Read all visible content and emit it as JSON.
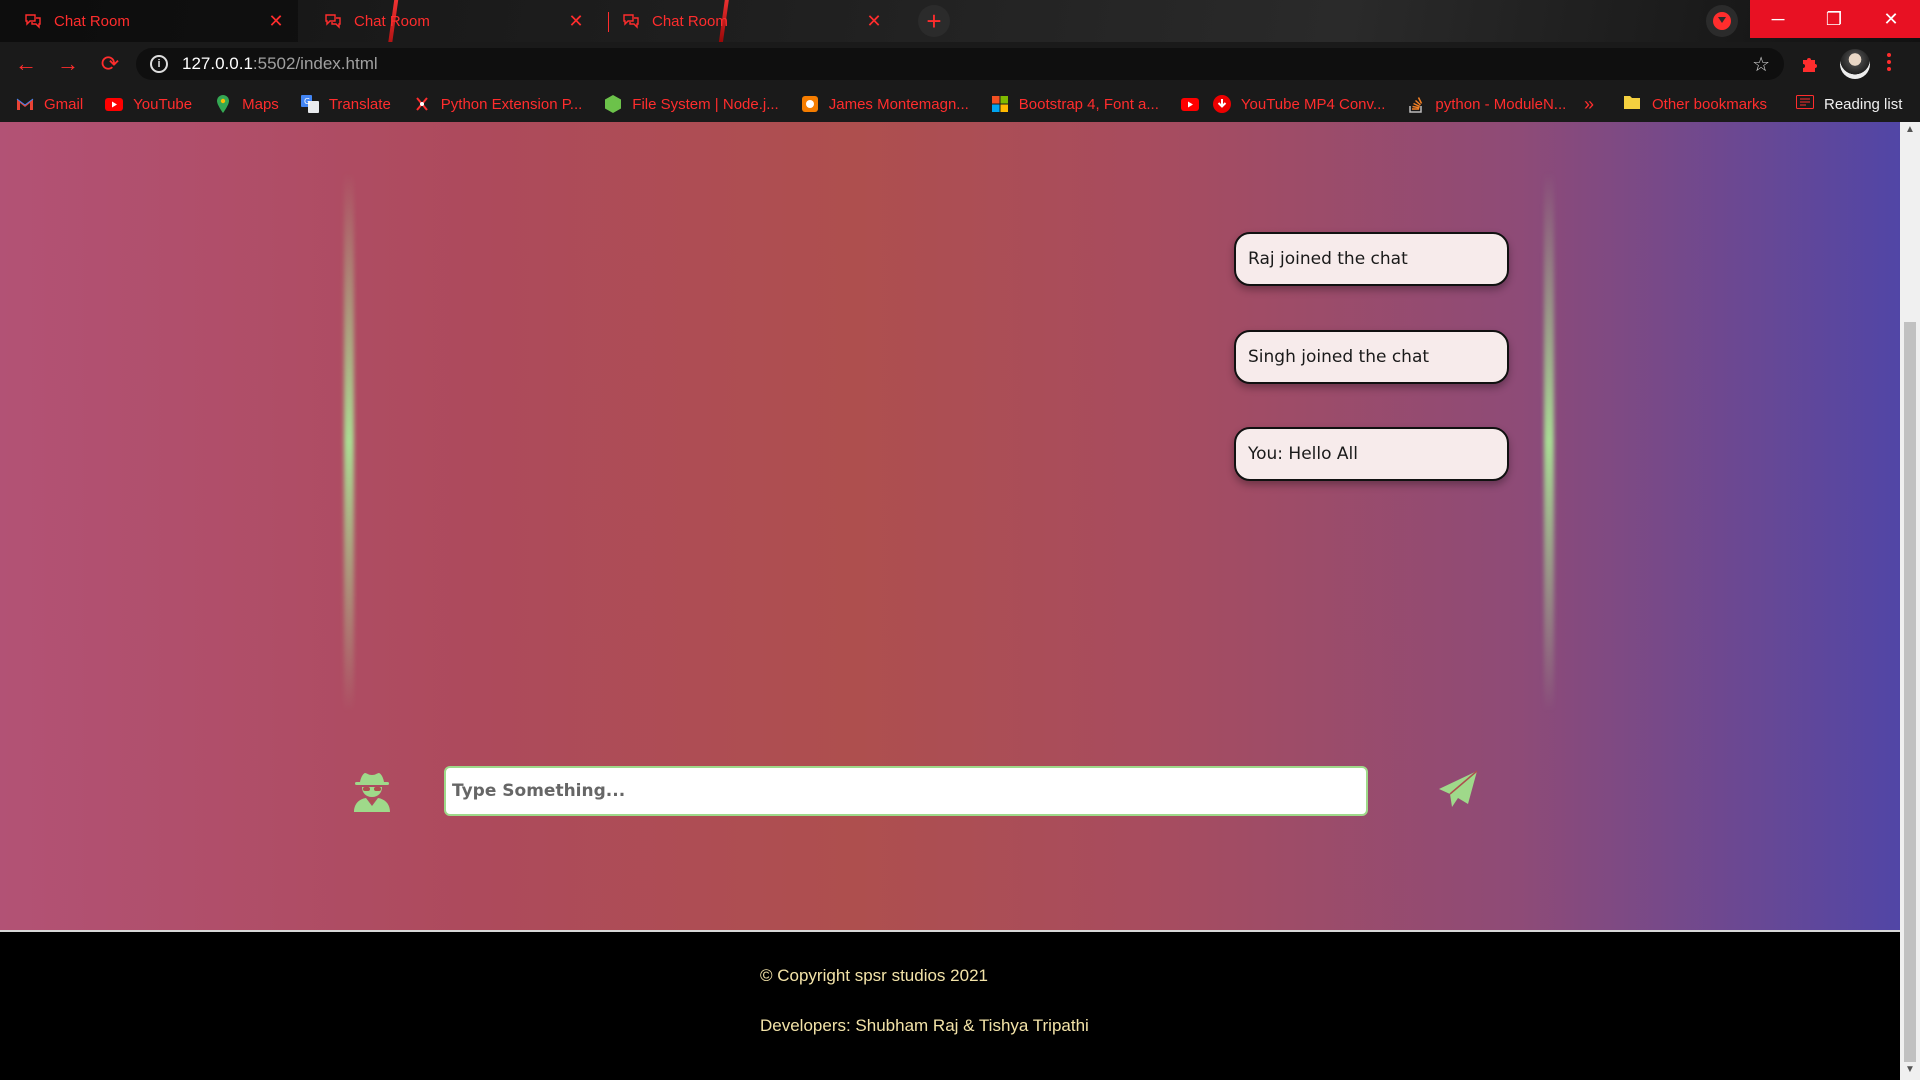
{
  "tabs": [
    {
      "title": "Chat Room",
      "close": "✕",
      "active": true
    },
    {
      "title": "Chat Room",
      "close": "✕",
      "active": false
    },
    {
      "title": "Chat Room",
      "close": "✕",
      "active": false
    }
  ],
  "new_tab": "+",
  "window_controls": {
    "minimize": "─",
    "maximize": "❐",
    "close": "✕"
  },
  "toolbar": {
    "back": "←",
    "forward": "→",
    "reload": "⟳",
    "url_host": "127.0.0.1",
    "url_rest": ":5502/index.html",
    "star": "☆"
  },
  "bookmarks": [
    {
      "label": "Gmail",
      "icon": "gmail-icon"
    },
    {
      "label": "YouTube",
      "icon": "youtube-icon"
    },
    {
      "label": "Maps",
      "icon": "maps-icon"
    },
    {
      "label": "Translate",
      "icon": "translate-icon"
    },
    {
      "label": "Python Extension P...",
      "icon": "python-ext-icon"
    },
    {
      "label": "File System | Node.j...",
      "icon": "node-icon"
    },
    {
      "label": "James Montemagn...",
      "icon": "blog-icon"
    },
    {
      "label": "Bootstrap 4, Font a...",
      "icon": "microsoft-icon"
    },
    {
      "label": "",
      "icon": "youtube-icon"
    },
    {
      "label": "YouTube MP4 Conv...",
      "icon": "download-icon"
    },
    {
      "label": "python - ModuleN...",
      "icon": "stackoverflow-icon"
    }
  ],
  "bookmarks_overflow": "»",
  "other_bookmarks": "Other bookmarks",
  "reading_list": "Reading list",
  "chat": {
    "messages": [
      "Raj joined the chat",
      "Singh joined the chat",
      "You: Hello All"
    ],
    "input_placeholder": "Type Something..."
  },
  "footer": {
    "copyright": "© Copyright spsr studios 2021",
    "developers": "Developers: Shubham Raj & Tishya Tripathi"
  },
  "colors": {
    "browser_accent": "#ff2d2d",
    "glow_green": "#9fd98a",
    "footer_text": "#f3e3a8"
  }
}
